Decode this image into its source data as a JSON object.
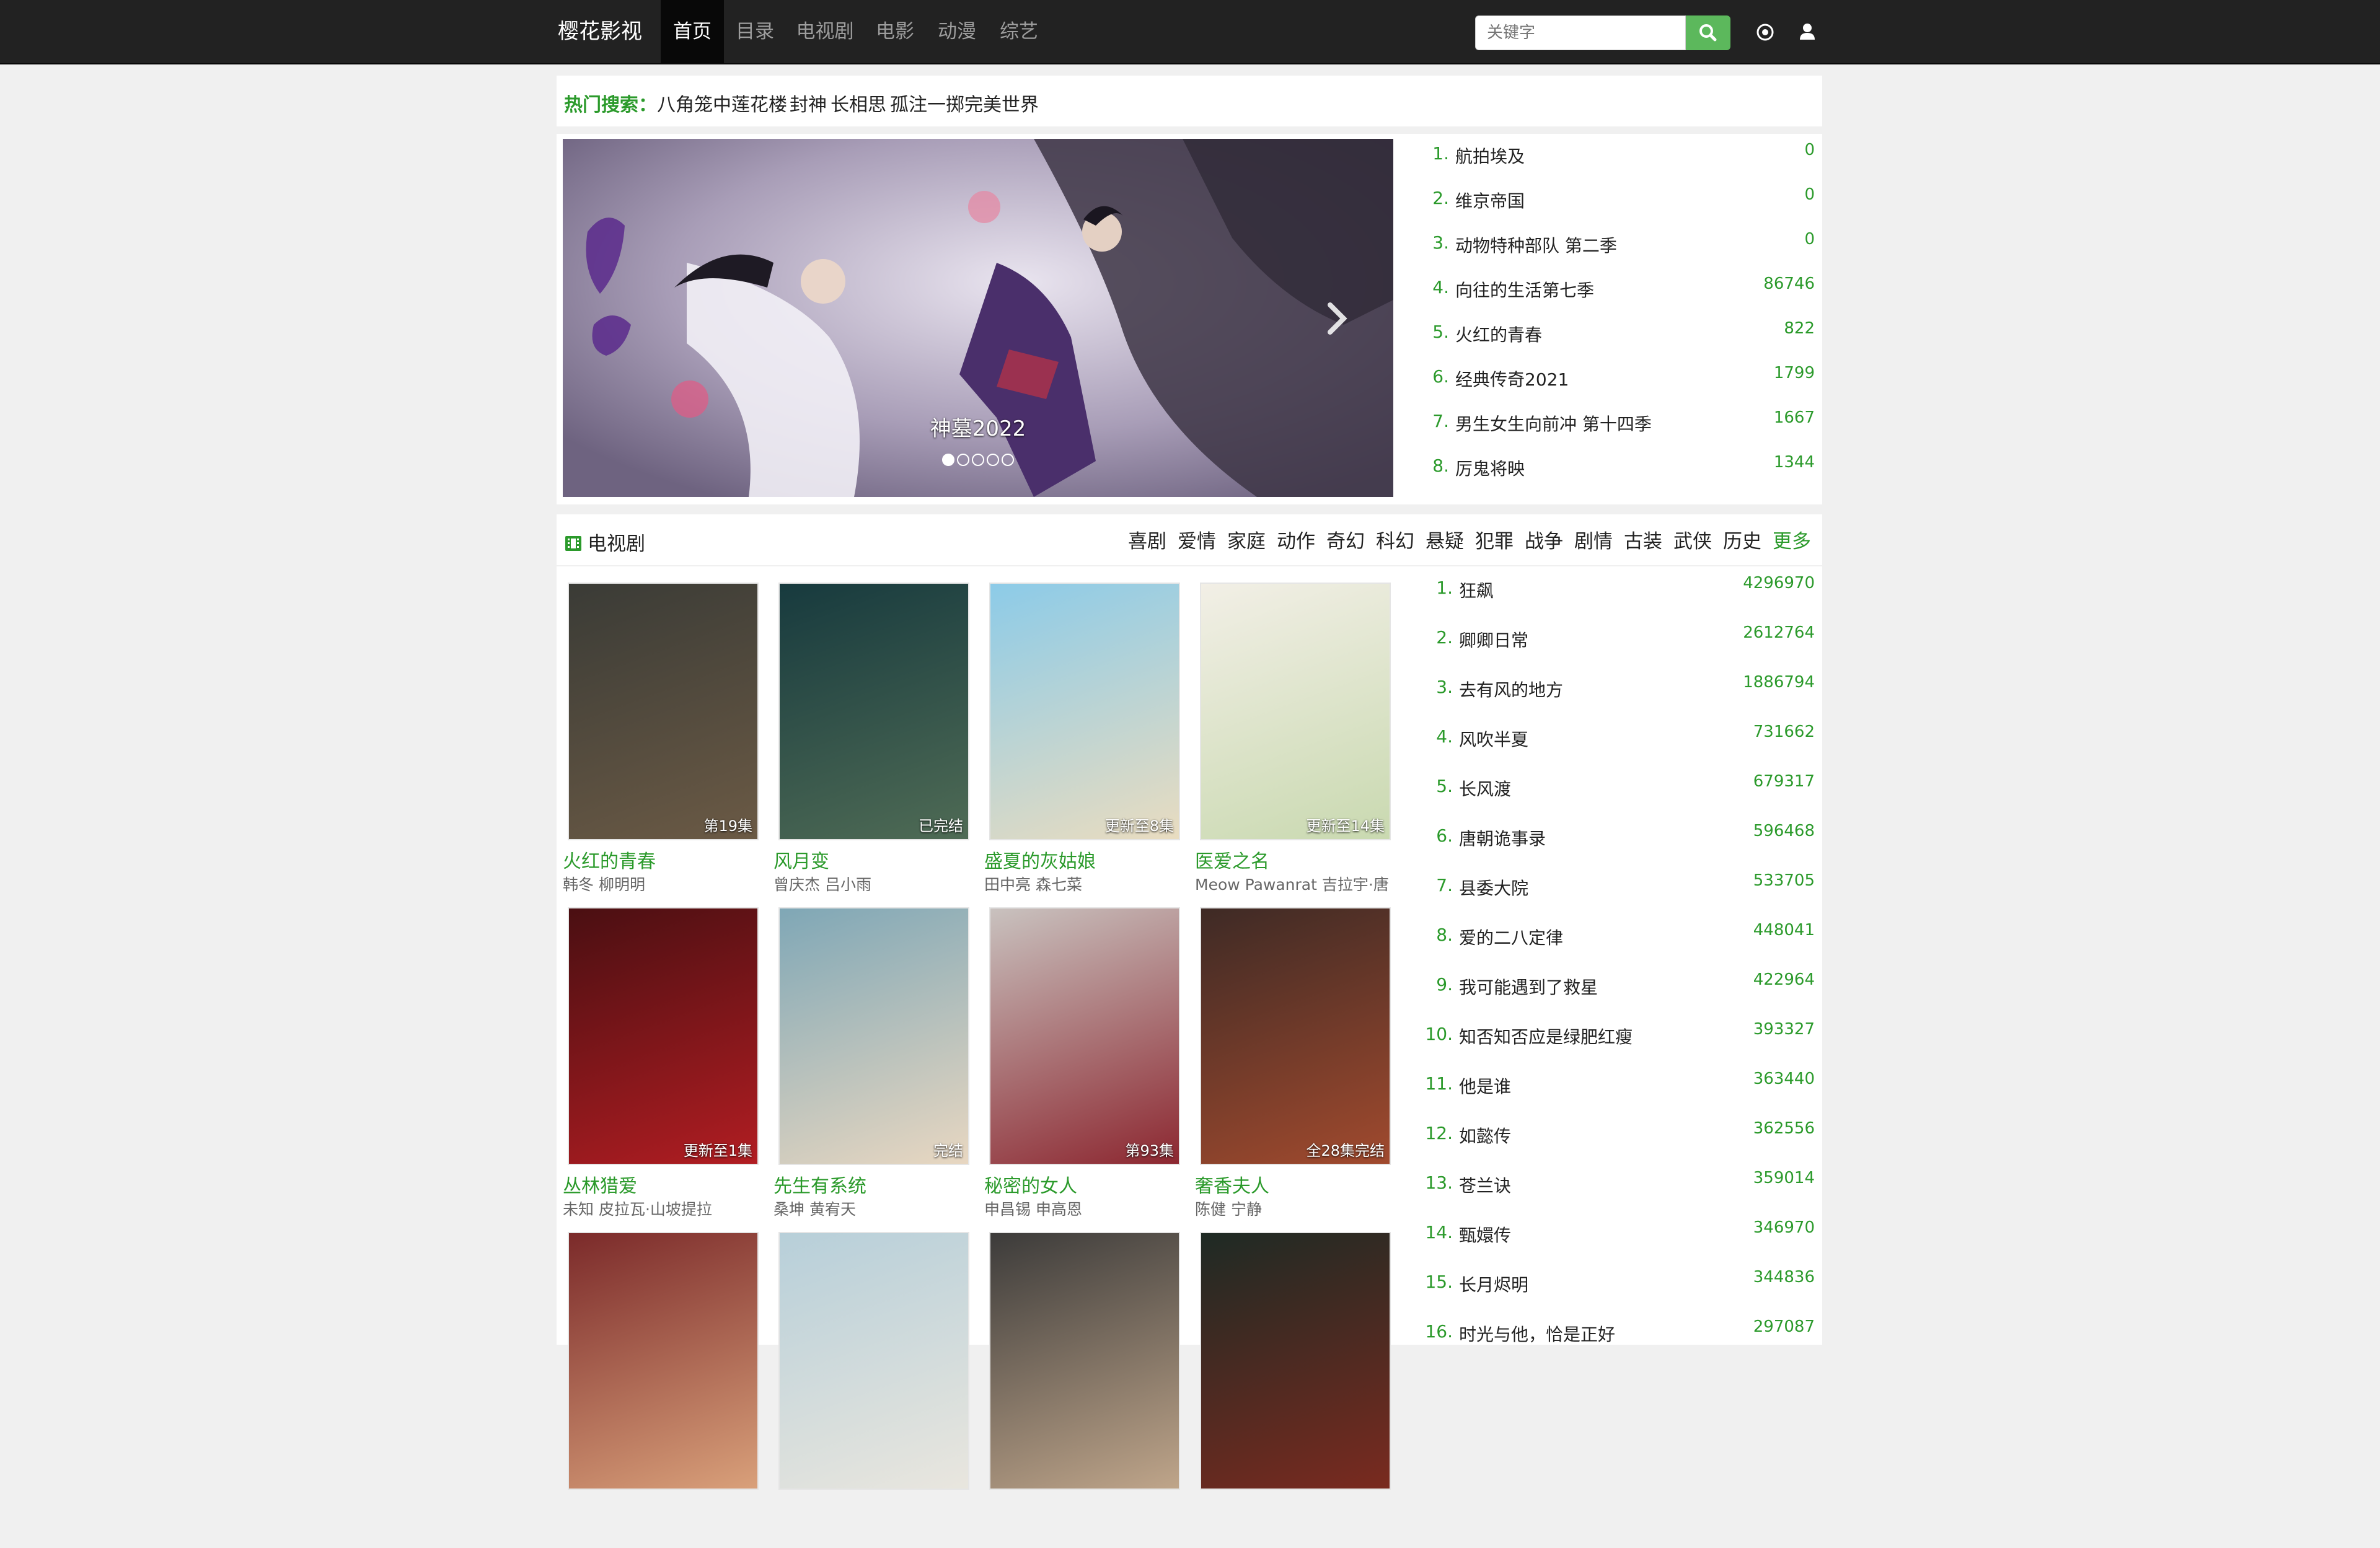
{
  "navbar": {
    "brand": "樱花影视",
    "links": [
      "首页",
      "目录",
      "电视剧",
      "电影",
      "动漫",
      "综艺"
    ],
    "search_placeholder": "关键字"
  },
  "hot_search": {
    "label": "热门搜索：",
    "terms": [
      "八角笼中",
      "莲花楼",
      "封神",
      "长相思",
      "孤注一掷",
      "完美世界"
    ]
  },
  "banner": {
    "caption": "神墓2022",
    "slide_count": 5,
    "active_slide": 1
  },
  "top_ranking": [
    {
      "rank": "1.",
      "title": "航拍埃及",
      "count": "0"
    },
    {
      "rank": "2.",
      "title": "维京帝国",
      "count": "0"
    },
    {
      "rank": "3.",
      "title": "动物特种部队 第二季",
      "count": "0"
    },
    {
      "rank": "4.",
      "title": "向往的生活第七季",
      "count": "86746"
    },
    {
      "rank": "5.",
      "title": "火红的青春",
      "count": "822"
    },
    {
      "rank": "6.",
      "title": "经典传奇2021",
      "count": "1799"
    },
    {
      "rank": "7.",
      "title": "男生女生向前冲 第十四季",
      "count": "1667"
    },
    {
      "rank": "8.",
      "title": "厉鬼将映",
      "count": "1344"
    }
  ],
  "tv_section": {
    "title": "电视剧",
    "genres": [
      "喜剧",
      "爱情",
      "家庭",
      "动作",
      "奇幻",
      "科幻",
      "悬疑",
      "犯罪",
      "战争",
      "剧情",
      "古装",
      "武侠",
      "历史"
    ],
    "more_label": "更多",
    "cards": [
      {
        "title": "火红的青春",
        "cast": "韩冬 柳明明",
        "badge": "第19集",
        "colors": [
          "#3a3b36",
          "#6b5a45"
        ]
      },
      {
        "title": "风月变",
        "cast": "曾庆杰 吕小雨",
        "badge": "已完结",
        "colors": [
          "#173a3e",
          "#4f6b55"
        ]
      },
      {
        "title": "盛夏的灰姑娘",
        "cast": "田中亮 森七菜",
        "badge": "更新至8集",
        "colors": [
          "#8ccbe8",
          "#e9dcc0"
        ]
      },
      {
        "title": "医爱之名",
        "cast": "Meow Pawanrat 吉拉宇·唐",
        "badge": "更新至14集",
        "colors": [
          "#f2efe6",
          "#c9d9b0"
        ]
      },
      {
        "title": "丛林猎爱",
        "cast": "未知 皮拉瓦·山坡提拉",
        "badge": "更新至1集",
        "colors": [
          "#4a0f12",
          "#b11d22"
        ]
      },
      {
        "title": "先生有系统",
        "cast": "桑坤 黄宥天",
        "badge": "完结",
        "colors": [
          "#7fa7b6",
          "#e8d7c1"
        ]
      },
      {
        "title": "秘密的女人",
        "cast": "申昌锡 申高恩",
        "badge": "第93集",
        "colors": [
          "#c9c2bf",
          "#8c2730"
        ]
      },
      {
        "title": "奢香夫人",
        "cast": "陈健 宁静",
        "badge": "全28集完结",
        "colors": [
          "#3e2a25",
          "#a14a2e"
        ]
      },
      {
        "title": "",
        "cast": "",
        "badge": "",
        "colors": [
          "#7b2a2a",
          "#d9a07a"
        ]
      },
      {
        "title": "",
        "cast": "",
        "badge": "",
        "colors": [
          "#b7cfd9",
          "#e9e6de"
        ]
      },
      {
        "title": "",
        "cast": "",
        "badge": "",
        "colors": [
          "#3c3b3a",
          "#bfa58a"
        ]
      },
      {
        "title": "",
        "cast": "",
        "badge": "",
        "colors": [
          "#1e2a24",
          "#7a2a1f"
        ]
      }
    ]
  },
  "tv_ranking": [
    {
      "rank": "1.",
      "title": "狂飙",
      "count": "4296970"
    },
    {
      "rank": "2.",
      "title": "卿卿日常",
      "count": "2612764"
    },
    {
      "rank": "3.",
      "title": "去有风的地方",
      "count": "1886794"
    },
    {
      "rank": "4.",
      "title": "风吹半夏",
      "count": "731662"
    },
    {
      "rank": "5.",
      "title": "长风渡",
      "count": "679317"
    },
    {
      "rank": "6.",
      "title": "唐朝诡事录",
      "count": "596468"
    },
    {
      "rank": "7.",
      "title": "县委大院",
      "count": "533705"
    },
    {
      "rank": "8.",
      "title": "爱的二八定律",
      "count": "448041"
    },
    {
      "rank": "9.",
      "title": "我可能遇到了救星",
      "count": "422964"
    },
    {
      "rank": "10.",
      "title": "知否知否应是绿肥红瘦",
      "count": "393327"
    },
    {
      "rank": "11.",
      "title": "他是谁",
      "count": "363440"
    },
    {
      "rank": "12.",
      "title": "如懿传",
      "count": "362556"
    },
    {
      "rank": "13.",
      "title": "苍兰诀",
      "count": "359014"
    },
    {
      "rank": "14.",
      "title": "甄嬛传",
      "count": "346970"
    },
    {
      "rank": "15.",
      "title": "长月烬明",
      "count": "344836"
    },
    {
      "rank": "16.",
      "title": "时光与他，恰是正好",
      "count": "297087"
    }
  ]
}
